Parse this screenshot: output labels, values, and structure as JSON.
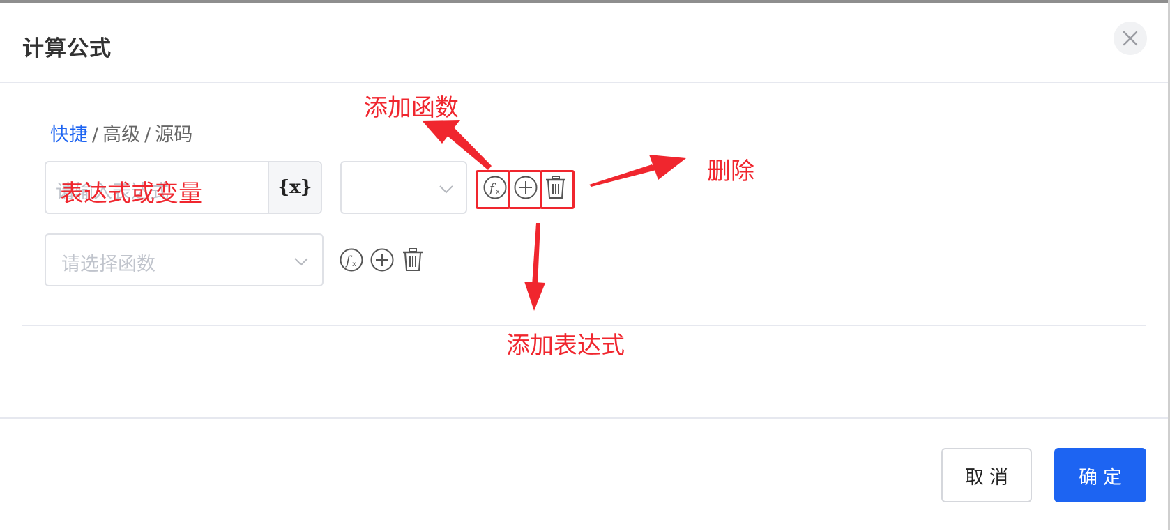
{
  "dialog": {
    "title": "计算公式",
    "close_icon": "close-icon"
  },
  "mode_tabs": {
    "quick": "快捷",
    "advanced": "高级",
    "source": "源码",
    "separator": "/"
  },
  "row1": {
    "expression_placeholder": "请输入表达式",
    "variable_button": "{x}",
    "operator_value": "",
    "icons": [
      "function-icon",
      "add-circle-icon",
      "trash-icon"
    ]
  },
  "row2": {
    "function_placeholder": "请选择函数",
    "icons": [
      "function-icon",
      "add-circle-icon",
      "trash-icon"
    ]
  },
  "footer": {
    "cancel_label": "取消",
    "ok_label": "确定"
  },
  "annotations": {
    "expression_or_variable": "表达式或变量",
    "add_function": "添加函数",
    "delete": "删除",
    "add_expression": "添加表达式"
  },
  "colors": {
    "primary": "#1d64f2",
    "annotation_red": "#f0262e",
    "placeholder": "#c0c4cc"
  }
}
